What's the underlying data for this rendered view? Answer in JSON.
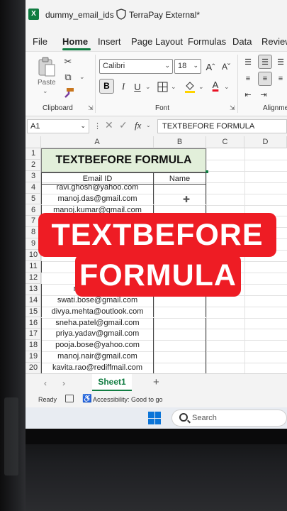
{
  "app": {
    "title": "dummy_email_ids",
    "sensitivity_label": "TerraPay External*"
  },
  "menu": {
    "tabs": [
      "File",
      "Home",
      "Insert",
      "Page Layout",
      "Formulas",
      "Data",
      "Review"
    ],
    "active": "Home"
  },
  "ribbon": {
    "clipboard": {
      "label": "Clipboard",
      "paste_label": "Paste"
    },
    "font": {
      "label": "Font",
      "font_name": "Calibri",
      "font_size": "18",
      "bold": "B",
      "italic": "I",
      "underline": "U"
    },
    "alignment": {
      "label": "Alignme"
    }
  },
  "formula_bar": {
    "name_box": "A1",
    "fx": "fx",
    "formula": "TEXTBEFORE FORMULA"
  },
  "sheet": {
    "columns": [
      "A",
      "B",
      "C",
      "D"
    ],
    "rows": [
      "1",
      "2",
      "3",
      "4",
      "5",
      "6",
      "7",
      "8",
      "9",
      "10",
      "11",
      "12",
      "13",
      "14",
      "15",
      "16",
      "17",
      "18",
      "19",
      "20"
    ],
    "title": "TEXTBEFORE FORMULA",
    "header_email": "Email ID",
    "header_name": "Name",
    "emails": {
      "r4": "ravi.ghosh@yahoo.com",
      "r5": "manoj.das@gmail.com",
      "r6": "manoj.kumar@gmail.com",
      "r11": "sur",
      "r13": "rajsingh@outl",
      "r14": "swati.bose@gmail.com",
      "r15": "divya.mehta@outlook.com",
      "r16": "sneha.patel@gmail.com",
      "r17": "priya.yadav@gmail.com",
      "r18": "pooja.bose@yahoo.com",
      "r19": "manoj.nair@gmail.com",
      "r20": "kavita.rao@rediffmail.com"
    }
  },
  "overlay": {
    "line1": "TEXTBEFORE",
    "line2": "FORMULA"
  },
  "sheet_tabs": {
    "active": "Sheet1",
    "add": "+"
  },
  "status": {
    "ready": "Ready",
    "accessibility": "Accessibility: Good to go"
  },
  "taskbar": {
    "search_placeholder": "Search"
  },
  "colors": {
    "excel_green": "#107c41",
    "title_fill": "#e2efda",
    "overlay_red": "#ee1c24"
  }
}
